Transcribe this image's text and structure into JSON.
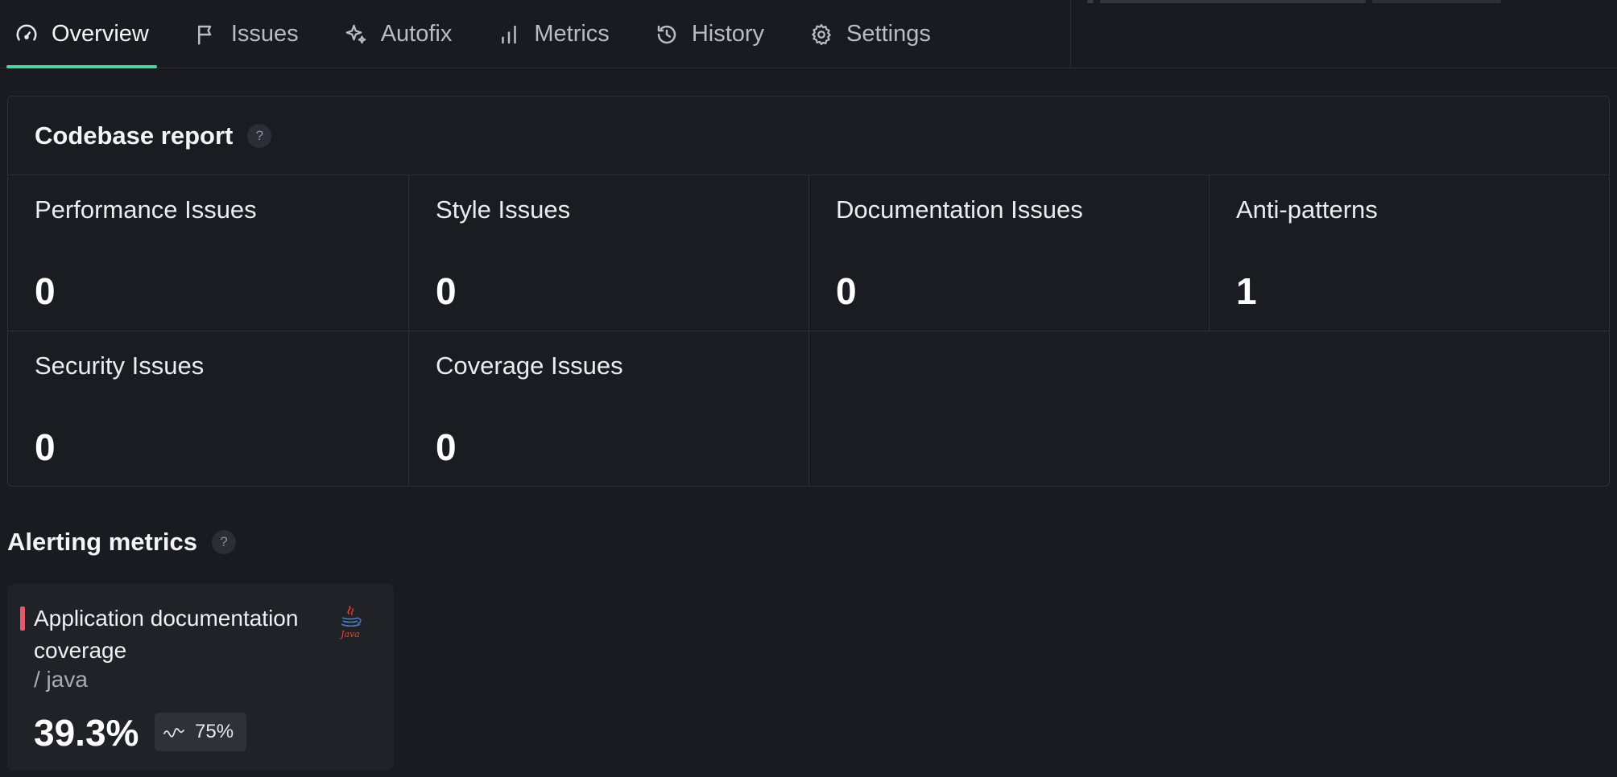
{
  "nav": {
    "tabs": [
      {
        "label": "Overview",
        "icon": "gauge-icon",
        "active": true
      },
      {
        "label": "Issues",
        "icon": "flag-icon",
        "active": false
      },
      {
        "label": "Autofix",
        "icon": "sparkles-icon",
        "active": false
      },
      {
        "label": "Metrics",
        "icon": "bar-chart-icon",
        "active": false
      },
      {
        "label": "History",
        "icon": "history-icon",
        "active": false
      },
      {
        "label": "Settings",
        "icon": "gear-icon",
        "active": false
      }
    ]
  },
  "report": {
    "title": "Codebase report",
    "help": "?",
    "cells": [
      {
        "label": "Performance Issues",
        "value": "0"
      },
      {
        "label": "Style Issues",
        "value": "0"
      },
      {
        "label": "Documentation Issues",
        "value": "0"
      },
      {
        "label": "Anti-patterns",
        "value": "1"
      },
      {
        "label": "Security Issues",
        "value": "0"
      },
      {
        "label": "Coverage Issues",
        "value": "0"
      }
    ]
  },
  "alerting": {
    "title": "Alerting metrics",
    "help": "?",
    "card": {
      "name": "Application documentation coverage",
      "language": "/ java",
      "language_logo": "java-logo",
      "value": "39.3%",
      "threshold": "75%",
      "threshold_icon": "trend-icon",
      "accent_color": "#e25a6b"
    }
  },
  "colors": {
    "background": "#1a1b20",
    "active_tab_underline": "#4fd1a1",
    "border": "#2e3037"
  }
}
